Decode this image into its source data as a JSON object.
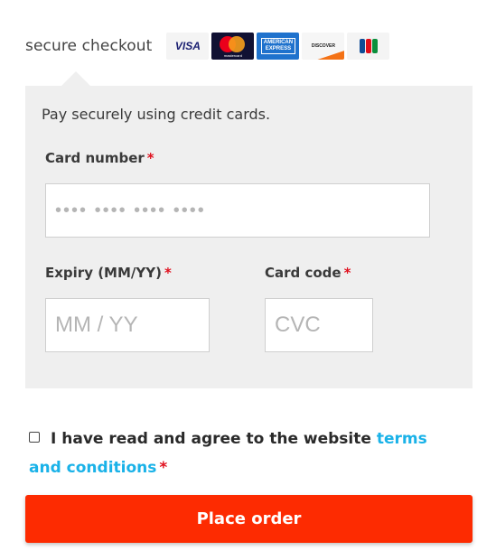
{
  "header": {
    "secure_label": "secure checkout",
    "cards": [
      {
        "name": "visa",
        "text": "VISA"
      },
      {
        "name": "mastercard",
        "text": "mastercard"
      },
      {
        "name": "amex",
        "line1": "AMERICAN",
        "line2": "EXPRESS"
      },
      {
        "name": "discover",
        "text": "DISCOVER"
      },
      {
        "name": "jcb",
        "text": "JCB"
      }
    ]
  },
  "panel": {
    "description": "Pay securely using credit cards.",
    "card_number": {
      "label": "Card number",
      "required": "*",
      "placeholder": "•••• •••• •••• ••••"
    },
    "expiry": {
      "label": "Expiry (MM/YY)",
      "required": "*",
      "placeholder": "MM / YY"
    },
    "card_code": {
      "label": "Card code",
      "required": "*",
      "placeholder": "CVC"
    }
  },
  "terms": {
    "text": "I have read and agree to the website ",
    "link_text": "terms and conditions",
    "required": "*"
  },
  "place_order_label": "Place order",
  "colors": {
    "accent_button": "#fd2b01",
    "link": "#1ab2e8",
    "required": "#e0101e",
    "panel_bg": "#efefef"
  }
}
